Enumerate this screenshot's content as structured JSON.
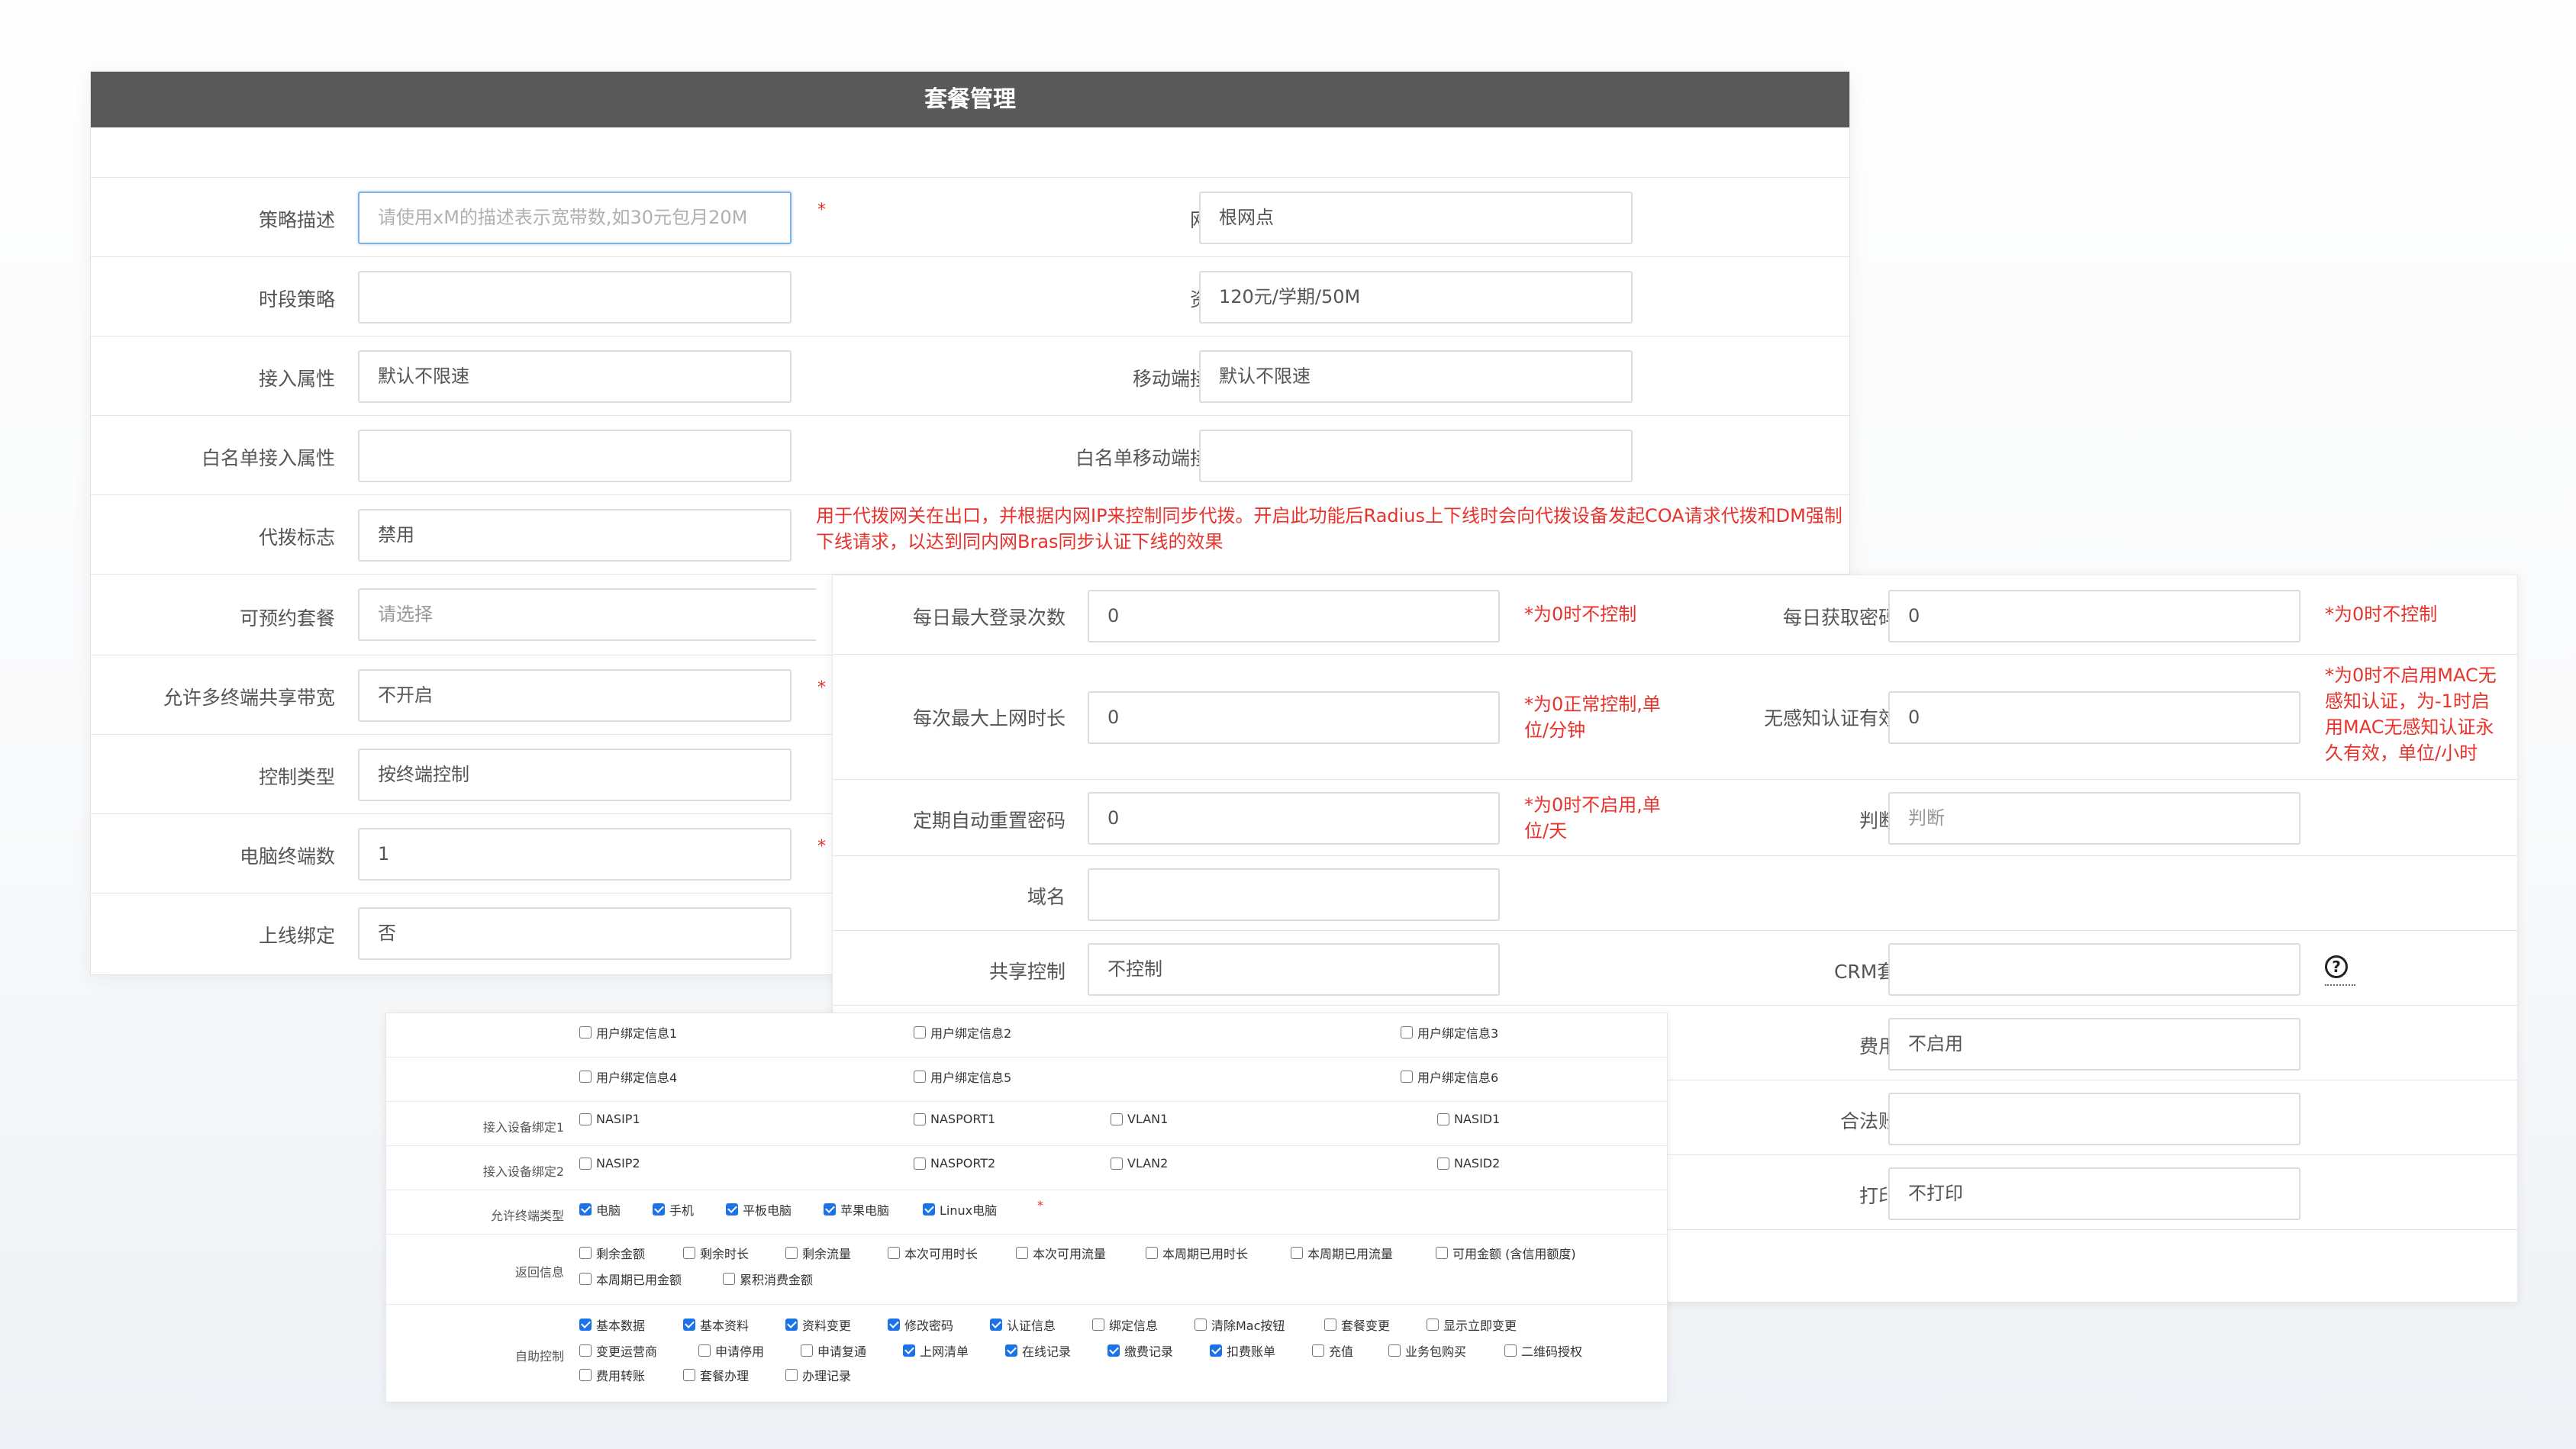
{
  "panel1": {
    "title": "套餐管理",
    "rows": [
      {
        "label": "策略描述",
        "placeholder": "请使用xM的描述表示宽带数,如30元包月20M",
        "star": "*",
        "right_label": "网点名称",
        "right_value": "根网点"
      },
      {
        "label": "时段策略",
        "value": "",
        "right_label": "资费配置",
        "right_value": "120元/学期/50M"
      },
      {
        "label": "接入属性",
        "value": "默认不限速",
        "right_label": "移动端接入属性",
        "right_value": "默认不限速"
      },
      {
        "label": "白名单接入属性",
        "value": "",
        "right_label": "白名单移动端接入属性",
        "right_value": ""
      },
      {
        "label": "代拨标志",
        "value": "禁用",
        "note": "用于代拨网关在出口，并根据内网IP来控制同步代拨。开启此功能后Radius上下线时会向代拨设备发起COA请求代拨和DM强制下线请求，以达到同内网Bras同步认证下线的效果"
      },
      {
        "label": "可预约套餐",
        "placeholder": "请选择"
      },
      {
        "label": "允许多终端共享带宽",
        "value": "不开启",
        "star": "*"
      },
      {
        "label": "控制类型",
        "value": "按终端控制"
      },
      {
        "label": "电脑终端数",
        "value": "1",
        "star": "*"
      },
      {
        "label": "上线绑定",
        "value": "否"
      }
    ]
  },
  "panel2": {
    "rows": [
      {
        "label": "每日最大登录次数",
        "value": "0",
        "note": "*为0时不控制",
        "right_label": "每日获取密码次数",
        "right_value": "0",
        "right_note": "*为0时不控制"
      },
      {
        "label": "每次最大上网时长",
        "value": "0",
        "note": "*为0正常控制,单位/分钟",
        "right_label": "无感知认证有效时间",
        "right_value": "0",
        "right_note": "*为0时不启用MAC无感知认证，为-1时启用MAC无感知认证永久有效，单位/小时"
      },
      {
        "label": "定期自动重置密码",
        "value": "0",
        "note": "*为0时不启用,单位/天",
        "right_label": "判断密码",
        "right_value": "判断"
      },
      {
        "label": "域名",
        "value": ""
      },
      {
        "label": "共享控制",
        "value": "不控制",
        "right_label": "CRM套餐ID",
        "right_value": "",
        "help": "?"
      },
      {
        "right_label": "费用转账",
        "right_value": "不启用"
      },
      {
        "right_label": "合法账号组",
        "right_value": ""
      },
      {
        "right_label": "打印标志",
        "right_value": "不打印"
      }
    ]
  },
  "panel3": {
    "bind_info_row1": [
      {
        "label": "用户绑定信息1",
        "checked": false
      },
      {
        "label": "用户绑定信息2",
        "checked": false
      },
      {
        "label": "用户绑定信息3",
        "checked": false
      }
    ],
    "bind_info_row2": [
      {
        "label": "用户绑定信息4",
        "checked": false
      },
      {
        "label": "用户绑定信息5",
        "checked": false
      },
      {
        "label": "用户绑定信息6",
        "checked": false
      }
    ],
    "device_bind1": {
      "label": "接入设备绑定1",
      "items": [
        {
          "label": "NASIP1",
          "checked": false
        },
        {
          "label": "NASPORT1",
          "checked": false
        },
        {
          "label": "VLAN1",
          "checked": false
        },
        {
          "label": "NASID1",
          "checked": false
        }
      ]
    },
    "device_bind2": {
      "label": "接入设备绑定2",
      "items": [
        {
          "label": "NASIP2",
          "checked": false
        },
        {
          "label": "NASPORT2",
          "checked": false
        },
        {
          "label": "VLAN2",
          "checked": false
        },
        {
          "label": "NASID2",
          "checked": false
        }
      ]
    },
    "terminal_types": {
      "label": "允许终端类型",
      "star": "*",
      "items": [
        {
          "label": "电脑",
          "checked": true
        },
        {
          "label": "手机",
          "checked": true
        },
        {
          "label": "平板电脑",
          "checked": true
        },
        {
          "label": "苹果电脑",
          "checked": true
        },
        {
          "label": "Linux电脑",
          "checked": true
        }
      ]
    },
    "return_info": {
      "label": "返回信息",
      "items": [
        {
          "label": "剩余金额",
          "checked": false
        },
        {
          "label": "剩余时长",
          "checked": false
        },
        {
          "label": "剩余流量",
          "checked": false
        },
        {
          "label": "本次可用时长",
          "checked": false
        },
        {
          "label": "本次可用流量",
          "checked": false
        },
        {
          "label": "本周期已用时长",
          "checked": false
        },
        {
          "label": "本周期已用流量",
          "checked": false
        },
        {
          "label": "可用金额 (含信用额度)",
          "checked": false
        },
        {
          "label": "本周期已用金额",
          "checked": false
        },
        {
          "label": "累积消费金额",
          "checked": false
        }
      ]
    },
    "self_service": {
      "label": "自助控制",
      "items": [
        {
          "label": "基本数据",
          "checked": true
        },
        {
          "label": "基本资料",
          "checked": true
        },
        {
          "label": "资料变更",
          "checked": true
        },
        {
          "label": "修改密码",
          "checked": true
        },
        {
          "label": "认证信息",
          "checked": true
        },
        {
          "label": "绑定信息",
          "checked": false
        },
        {
          "label": "清除Mac按钮",
          "checked": false
        },
        {
          "label": "套餐变更",
          "checked": false
        },
        {
          "label": "显示立即变更",
          "checked": false
        },
        {
          "label": "变更运营商",
          "checked": false
        },
        {
          "label": "申请停用",
          "checked": false
        },
        {
          "label": "申请复通",
          "checked": false
        },
        {
          "label": "上网清单",
          "checked": true
        },
        {
          "label": "在线记录",
          "checked": true
        },
        {
          "label": "缴费记录",
          "checked": true
        },
        {
          "label": "扣费账单",
          "checked": true
        },
        {
          "label": "充值",
          "checked": false
        },
        {
          "label": "业务包购买",
          "checked": false
        },
        {
          "label": "二维码授权",
          "checked": false
        },
        {
          "label": "费用转账",
          "checked": false
        },
        {
          "label": "套餐办理",
          "checked": false
        },
        {
          "label": "办理记录",
          "checked": false
        }
      ]
    }
  }
}
